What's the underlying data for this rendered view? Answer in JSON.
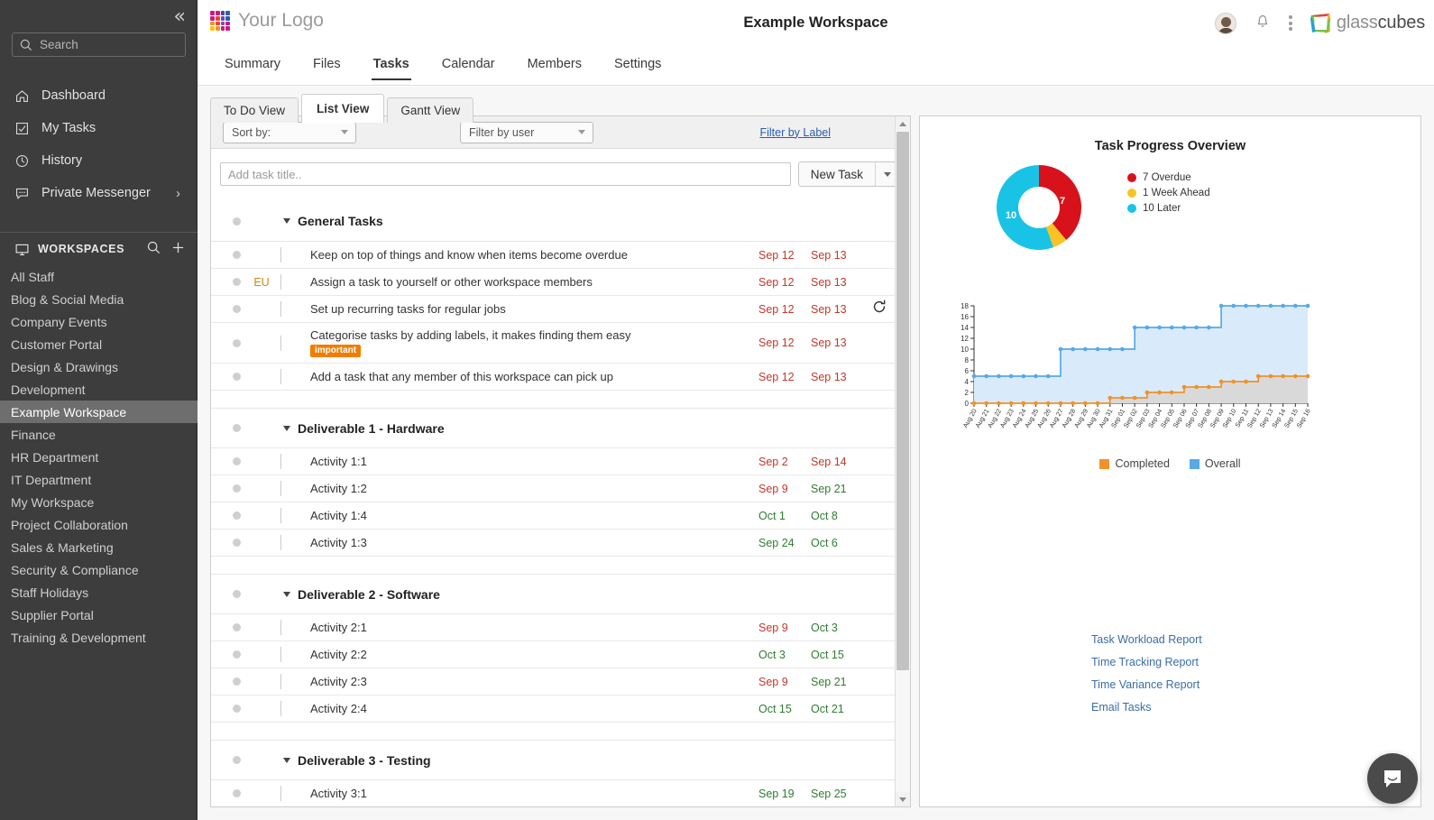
{
  "sidebar": {
    "collapse_icon": "double-chevron-left-icon",
    "search": {
      "placeholder": "Search",
      "value": ""
    },
    "nav": [
      {
        "label": "Dashboard",
        "icon": "home-icon"
      },
      {
        "label": "My Tasks",
        "icon": "checkbox-icon"
      },
      {
        "label": "History",
        "icon": "clock-icon"
      },
      {
        "label": "Private Messenger",
        "icon": "message-icon",
        "chevron": "›"
      }
    ],
    "workspaces_header": "WORKSPACES",
    "workspaces": [
      "All Staff",
      "Blog & Social Media",
      "Company Events",
      "Customer Portal",
      "Design & Drawings",
      "Development",
      "Example Workspace",
      "Finance",
      "HR Department",
      "IT Department",
      "My Workspace",
      "Project Collaboration",
      "Sales & Marketing",
      "Security & Compliance",
      "Staff Holidays",
      "Supplier Portal",
      "Training & Development"
    ],
    "active_workspace": "Example Workspace"
  },
  "header": {
    "logo_text": "Your Logo",
    "workspace_title": "Example Workspace",
    "brand_name_light": "glass",
    "brand_name_dark": "cubes",
    "icons": [
      "avatar",
      "bell-icon",
      "kebab-menu-icon",
      "glasscubes-logo"
    ]
  },
  "tabs": [
    {
      "label": "Summary",
      "active": false
    },
    {
      "label": "Files",
      "active": false
    },
    {
      "label": "Tasks",
      "active": true
    },
    {
      "label": "Calendar",
      "active": false
    },
    {
      "label": "Members",
      "active": false
    },
    {
      "label": "Settings",
      "active": false
    }
  ],
  "subtabs": [
    {
      "label": "To Do View",
      "active": false
    },
    {
      "label": "List View",
      "active": true
    },
    {
      "label": "Gantt View",
      "active": false
    }
  ],
  "filterbar": {
    "sort_by": "Sort by:",
    "filter_by_user": "Filter by user",
    "filter_by_label": "Filter by Label"
  },
  "addtask": {
    "placeholder": "Add task title..",
    "value": "",
    "button_label": "New Task"
  },
  "task_groups": [
    {
      "title": "General Tasks",
      "tasks": [
        {
          "title": "Keep on top of things and know when items become overdue",
          "assignee": "",
          "start": "Sep 12",
          "start_color": "red",
          "due": "Sep 13",
          "due_color": "red",
          "label": "",
          "recurring": false
        },
        {
          "title": "Assign a task to yourself or other workspace members",
          "assignee": "EU",
          "start": "Sep 12",
          "start_color": "red",
          "due": "Sep 13",
          "due_color": "red",
          "label": "",
          "recurring": false
        },
        {
          "title": "Set up recurring tasks for regular jobs",
          "assignee": "",
          "start": "Sep 12",
          "start_color": "red",
          "due": "Sep 13",
          "due_color": "red",
          "label": "",
          "recurring": true
        },
        {
          "title": "Categorise tasks by adding labels, it makes finding them easy",
          "assignee": "",
          "start": "Sep 12",
          "start_color": "red",
          "due": "Sep 13",
          "due_color": "red",
          "label": "important",
          "recurring": false
        },
        {
          "title": "Add a task that any member of this workspace can pick up",
          "assignee": "",
          "start": "Sep 12",
          "start_color": "red",
          "due": "Sep 13",
          "due_color": "red",
          "label": "",
          "recurring": false
        }
      ]
    },
    {
      "title": "Deliverable 1 - Hardware",
      "tasks": [
        {
          "title": "Activity 1:1",
          "assignee": "",
          "start": "Sep 2",
          "start_color": "red",
          "due": "Sep 14",
          "due_color": "red",
          "label": "",
          "recurring": false
        },
        {
          "title": "Activity 1:2",
          "assignee": "",
          "start": "Sep 9",
          "start_color": "red",
          "due": "Sep 21",
          "due_color": "green",
          "label": "",
          "recurring": false
        },
        {
          "title": "Activity 1:4",
          "assignee": "",
          "start": "Oct 1",
          "start_color": "green",
          "due": "Oct 8",
          "due_color": "green",
          "label": "",
          "recurring": false
        },
        {
          "title": "Activity 1:3",
          "assignee": "",
          "start": "Sep 24",
          "start_color": "green",
          "due": "Oct 6",
          "due_color": "green",
          "label": "",
          "recurring": false
        }
      ]
    },
    {
      "title": "Deliverable 2 - Software",
      "tasks": [
        {
          "title": "Activity 2:1",
          "assignee": "",
          "start": "Sep 9",
          "start_color": "red",
          "due": "Oct 3",
          "due_color": "green",
          "label": "",
          "recurring": false
        },
        {
          "title": "Activity 2:2",
          "assignee": "",
          "start": "Oct 3",
          "start_color": "green",
          "due": "Oct 15",
          "due_color": "green",
          "label": "",
          "recurring": false
        },
        {
          "title": "Activity 2:3",
          "assignee": "",
          "start": "Sep 9",
          "start_color": "red",
          "due": "Sep 21",
          "due_color": "green",
          "label": "",
          "recurring": false
        },
        {
          "title": "Activity 2:4",
          "assignee": "",
          "start": "Oct 15",
          "start_color": "green",
          "due": "Oct 21",
          "due_color": "green",
          "label": "",
          "recurring": false
        }
      ]
    },
    {
      "title": "Deliverable 3 - Testing",
      "tasks": [
        {
          "title": "Activity 3:1",
          "assignee": "",
          "start": "Sep 19",
          "start_color": "green",
          "due": "Sep 25",
          "due_color": "green",
          "label": "",
          "recurring": false
        }
      ]
    }
  ],
  "right_panel": {
    "report_links": [
      "Task Workload Report",
      "Time Tracking Report",
      "Time Variance Report",
      "Email Tasks"
    ]
  },
  "colors": {
    "overdue": "#d8121a",
    "week_ahead": "#f8c324",
    "later": "#19c3e6",
    "completed": "#f0922b",
    "overall": "#57a9e8",
    "overall_fill": "#d9ebfa",
    "completed_fill": "#d9d9d9",
    "label_orange": "#f07d00",
    "link_blue": "#3a6ea5"
  },
  "chart_data": [
    {
      "type": "pie",
      "title": "Task Progress Overview",
      "labels": [
        "7 Overdue",
        "1 Week Ahead",
        "10 Later"
      ],
      "categories": [
        "Overdue",
        "Week Ahead",
        "Later"
      ],
      "values": [
        7,
        1,
        10
      ],
      "slice_labels": [
        "7",
        "",
        "10"
      ],
      "colors": [
        "#d8121a",
        "#f8c324",
        "#19c3e6"
      ],
      "legend_position": "right",
      "donut": true
    },
    {
      "type": "area",
      "title": "",
      "xlabel": "",
      "ylabel": "",
      "ylim": [
        0,
        18
      ],
      "yticks": [
        0,
        2,
        4,
        6,
        8,
        10,
        12,
        14,
        16,
        18
      ],
      "grid": false,
      "legend_position": "bottom",
      "x": [
        "Aug 20",
        "Aug 21",
        "Aug 22",
        "Aug 23",
        "Aug 24",
        "Aug 25",
        "Aug 26",
        "Aug 27",
        "Aug 28",
        "Aug 29",
        "Aug 30",
        "Aug 31",
        "Sep 01",
        "Sep 02",
        "Sep 03",
        "Sep 04",
        "Sep 05",
        "Sep 06",
        "Sep 07",
        "Sep 08",
        "Sep 09",
        "Sep 10",
        "Sep 11",
        "Sep 12",
        "Sep 13",
        "Sep 14",
        "Sep 15",
        "Sep 16"
      ],
      "series": [
        {
          "name": "Completed",
          "color": "#f0922b",
          "values": [
            0,
            0,
            0,
            0,
            0,
            0,
            0,
            0,
            0,
            0,
            0,
            1,
            1,
            1,
            2,
            2,
            2,
            3,
            3,
            3,
            4,
            4,
            4,
            5,
            5,
            5,
            5,
            5
          ]
        },
        {
          "name": "Overall",
          "color": "#57a9e8",
          "values": [
            5,
            5,
            5,
            5,
            5,
            5,
            5,
            10,
            10,
            10,
            10,
            10,
            10,
            14,
            14,
            14,
            14,
            14,
            14,
            14,
            18,
            18,
            18,
            18,
            18,
            18,
            18,
            18
          ]
        }
      ]
    }
  ]
}
